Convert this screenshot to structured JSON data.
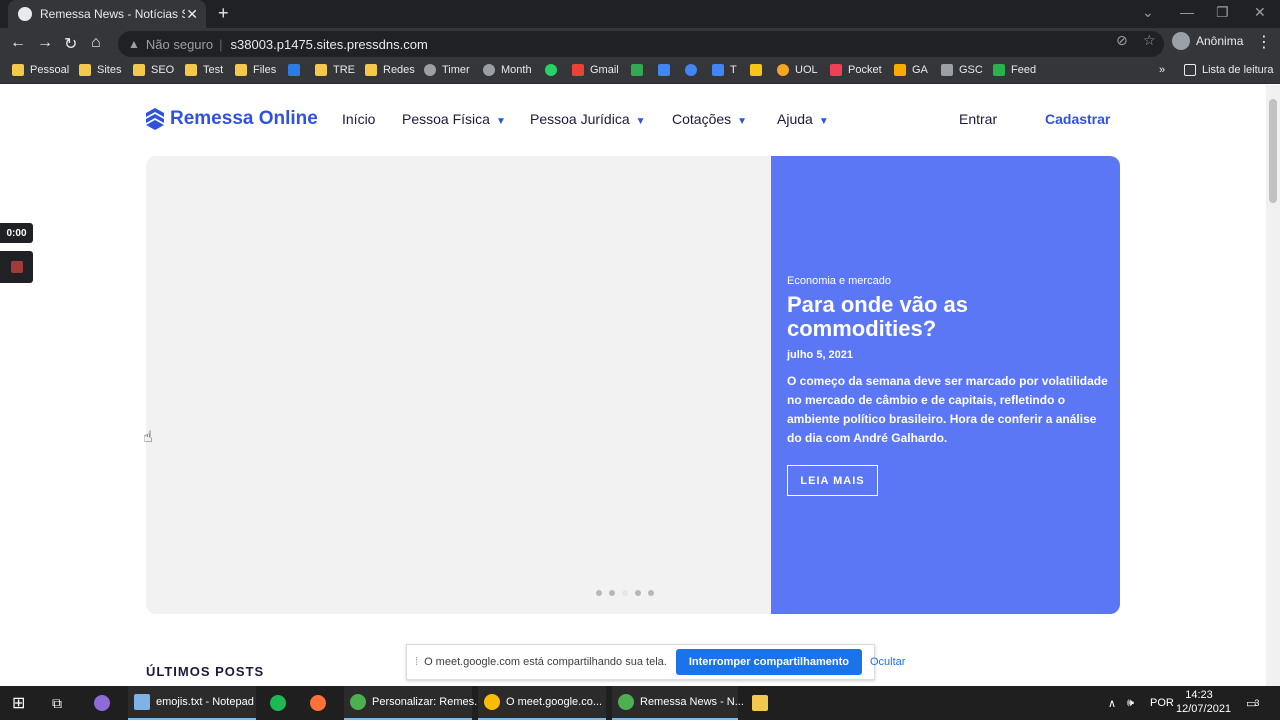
{
  "browser": {
    "tab_title": "Remessa News - Notícias Sobre Câmbio",
    "tab_close": "✕",
    "new_tab": "+",
    "insecure_label": "Não seguro",
    "url": "s38003.p1475.sites.pressdns.com",
    "profile_name": "Anônima",
    "bookmarks": [
      "Pessoal",
      "Sites",
      "SEO",
      "Test",
      "Files",
      "",
      "TRE",
      "Redes",
      "Timer",
      "Month",
      "",
      "Gmail",
      "",
      "",
      "",
      "T",
      "",
      "UOL",
      "Pocket",
      "GA",
      "GSC",
      "Feed"
    ],
    "reading_list": "Lista de leitura",
    "overflow": "»"
  },
  "site": {
    "logo_text": "Remessa Online",
    "nav": [
      "Início",
      "Pessoa Física",
      "Pessoa Jurídica",
      "Cotações",
      "Ajuda"
    ],
    "login": "Entrar",
    "signup": "Cadastrar",
    "hero": {
      "category": "Economia e mercado",
      "headline": "Para onde vão as commodities?",
      "date": "julho 5, 2021",
      "excerpt": "O começo da semana deve ser marcado por volatilidade no mercado de câmbio e de capitais, refletindo o ambiente político brasileiro. Hora de conferir a análise do dia com André Galhardo.",
      "read_more": "LEIA MAIS",
      "slide_count": 5,
      "active_slide": 3
    },
    "latest_posts": "ÚLTIMOS POSTS"
  },
  "recorder": {
    "timer": "0:00"
  },
  "share_bar": {
    "message": "O meet.google.com está compartilhando sua tela.",
    "stop": "Interromper compartilhamento",
    "hide": "Ocultar"
  },
  "taskbar": {
    "items": [
      "emojis.txt - Notepad",
      "Personalizar: Remes...",
      "O meet.google.co...",
      "Remessa News - N..."
    ],
    "language": "POR",
    "time": "14:23",
    "date": "12/07/2021",
    "notifications": "3"
  }
}
